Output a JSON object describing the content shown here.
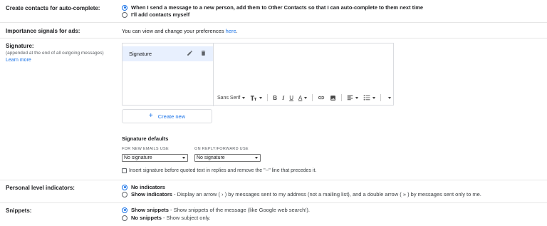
{
  "autocomplete": {
    "label": "Create contacts for auto-complete:",
    "options": [
      {
        "text": "When I send a message to a new person, add them to Other Contacts so that I can auto-complete to them next time",
        "checked": true
      },
      {
        "text": "I'll add contacts myself",
        "checked": false
      }
    ]
  },
  "ads": {
    "label": "Importance signals for ads:",
    "text": "You can view and change your preferences ",
    "link": "here",
    "after": "."
  },
  "signature": {
    "label": "Signature:",
    "sublabel": "(appended at the end of all outgoing messages)",
    "learn_more": "Learn more",
    "items": [
      {
        "name": "Signature"
      }
    ],
    "toolbar": {
      "font": "Sans Serif",
      "size_icon": "text-size-icon",
      "bold": "B",
      "italic": "I",
      "underline": "U",
      "text_color": "A"
    },
    "create_new": "Create new",
    "defaults_title": "Signature defaults",
    "new_emails_label": "FOR NEW EMAILS USE",
    "reply_label": "ON REPLY/FORWARD USE",
    "new_emails_value": "No signature",
    "reply_value": "No signature",
    "insert_before": "Insert signature before quoted text in replies and remove the \"--\" line that precedes it."
  },
  "personal": {
    "label": "Personal level indicators:",
    "options": [
      {
        "title": "No indicators",
        "desc": "",
        "checked": true
      },
      {
        "title": "Show indicators",
        "desc": " - Display an arrow ( › ) by messages sent to my address (not a mailing list), and a double arrow ( » ) by messages sent only to me.",
        "checked": false
      }
    ]
  },
  "snippets": {
    "label": "Snippets:",
    "options": [
      {
        "title": "Show snippets",
        "desc": " - Show snippets of the message (like Google web search!).",
        "checked": true
      },
      {
        "title": "No snippets",
        "desc": " - Show subject only.",
        "checked": false
      }
    ]
  },
  "colors": {
    "accent": "#1a73e8",
    "selected_bg": "#e8f0fe",
    "divider": "#e6e6e6"
  }
}
